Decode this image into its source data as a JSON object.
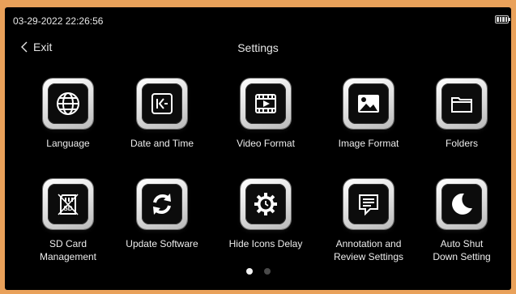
{
  "status": {
    "datetime": "03-29-2022 22:26:56",
    "battery_icon": "battery-full-icon"
  },
  "header": {
    "exit_label": "Exit",
    "title": "Settings"
  },
  "tiles": [
    {
      "label": "Language",
      "icon": "globe-icon"
    },
    {
      "label": "Date and Time",
      "icon": "date-time-icon"
    },
    {
      "label": "Video Format",
      "icon": "film-icon"
    },
    {
      "label": "Image Format",
      "icon": "image-icon"
    },
    {
      "label": "Folders",
      "icon": "folder-icon"
    },
    {
      "label": "SD Card\nManagement",
      "icon": "sd-card-icon"
    },
    {
      "label": "Update Software",
      "icon": "refresh-icon"
    },
    {
      "label": "Hide Icons Delay",
      "icon": "gear-clock-icon"
    },
    {
      "label": "Annotation and\nReview Settings",
      "icon": "comment-icon"
    },
    {
      "label": "Auto Shut\nDown Setting",
      "icon": "moon-icon"
    }
  ],
  "pagination": {
    "pages": 2,
    "current": 1
  },
  "colors": {
    "background": "#000000",
    "bezel": "#e9a15a",
    "text": "#ededed"
  }
}
